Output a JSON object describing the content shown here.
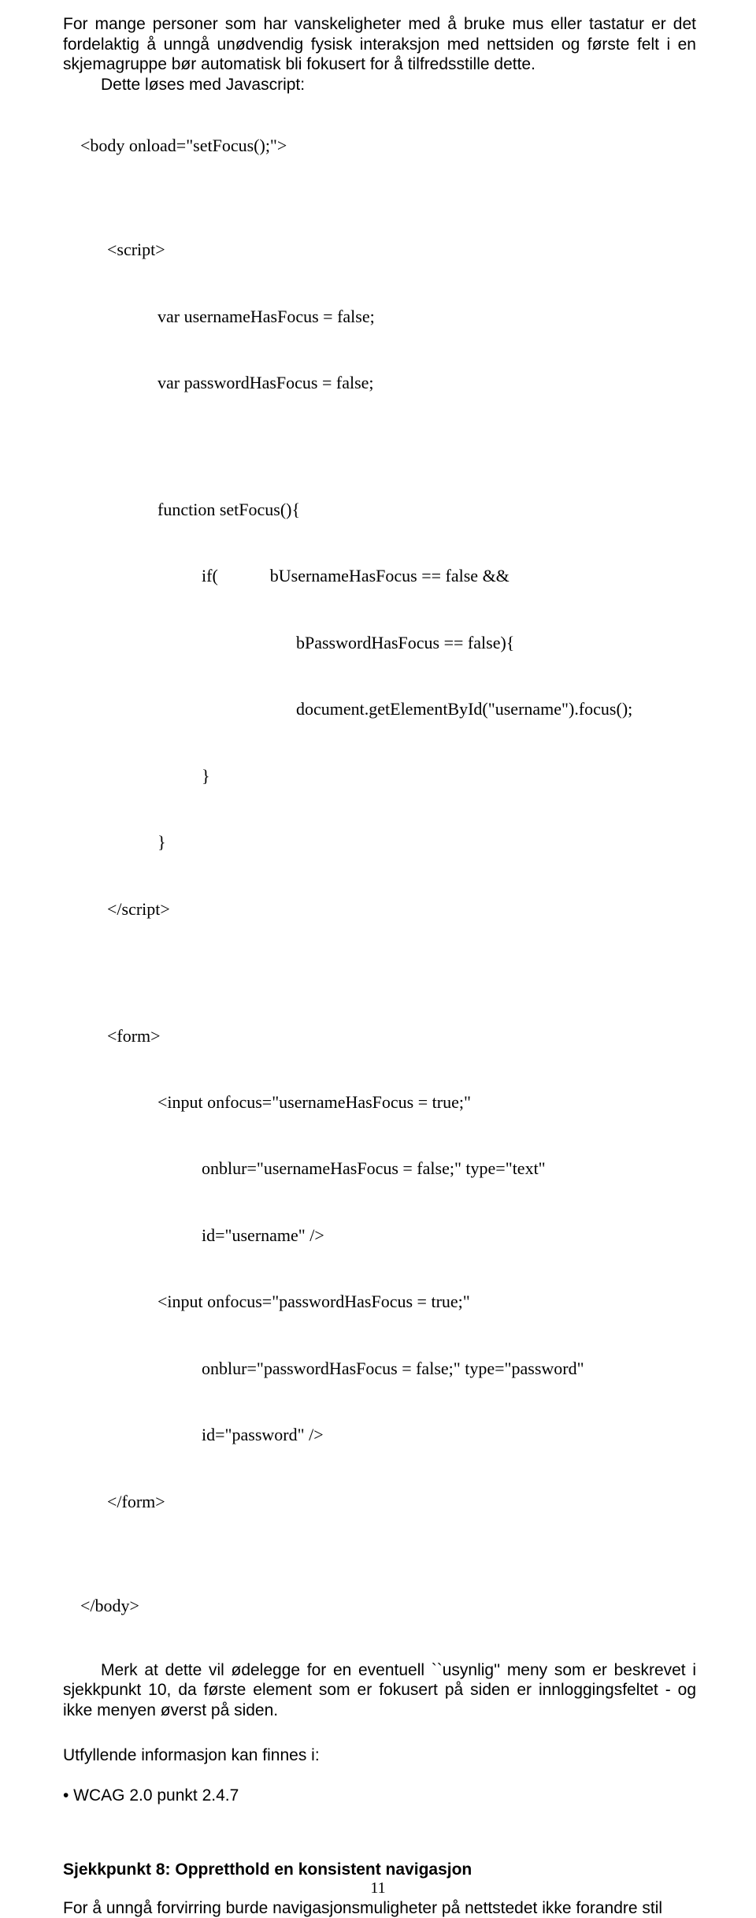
{
  "intro": {
    "p1": "For mange personer som har vanskeligheter med å bruke mus eller tastatur er det fordelaktig å unngå unødvendig fysisk interaksjon med nettsiden og første felt i en skjemagruppe bør automatisk bli fokusert for å tilfredsstille dette.",
    "p2": "Dette løses med Javascript:"
  },
  "code": {
    "l1": "<body onload=\"setFocus();\">",
    "l2": "<script>",
    "l3": "var usernameHasFocus = false;",
    "l4": "var passwordHasFocus = false;",
    "l5": "function setFocus(){",
    "l6a": "if(",
    "l6b": "bUsernameHasFocus == false &&",
    "l7": "bPasswordHasFocus == false){",
    "l8": "document.getElementById(\"username\").focus();",
    "l9": "}",
    "l10": "}",
    "l11": "</script>",
    "l12": "<form>",
    "l13": "<input onfocus=\"usernameHasFocus = true;\"",
    "l14": "onblur=\"usernameHasFocus = false;\" type=\"text\"",
    "l15": "id=\"username\" />",
    "l16": "<input onfocus=\"passwordHasFocus = true;\"",
    "l17": "onblur=\"passwordHasFocus = false;\" type=\"password\"",
    "l18": "id=\"password\" />",
    "l19": "</form>",
    "l20": "</body>"
  },
  "note": "Merk at dette vil ødelegge for en eventuell ``usynlig'' meny som er beskrevet i sjekkpunkt 10, da første element som er fokusert på siden er innloggingsfeltet - og ikke menyen øverst på siden.",
  "refs_heading": "Utfyllende informasjon kan finnes i:",
  "refs_item": "• WCAG 2.0 punkt 2.4.7",
  "section_heading": "Sjekkpunkt 8: Oppretthold en konsistent navigasjon",
  "section_body": "For å unngå forvirring burde navigasjonsmuligheter på nettstedet ikke forandre stil",
  "page_number": "11"
}
